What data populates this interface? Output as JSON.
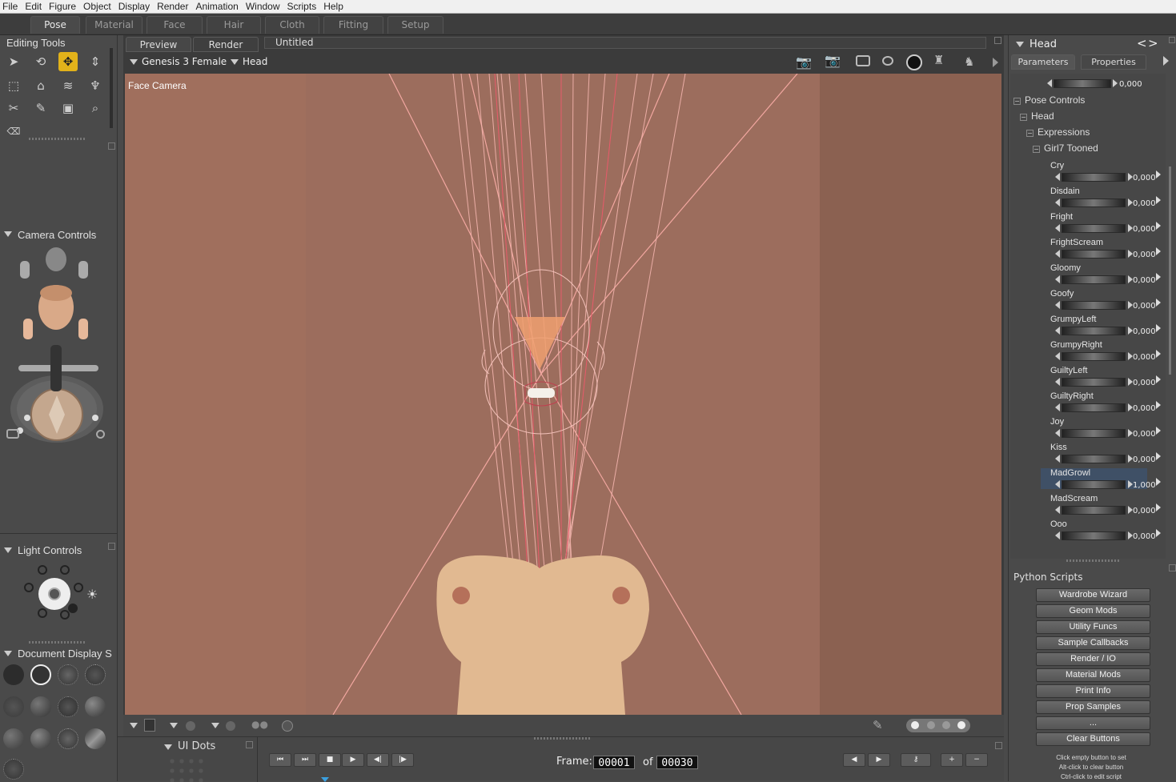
{
  "menu": [
    "File",
    "Edit",
    "Figure",
    "Object",
    "Display",
    "Render",
    "Animation",
    "Window",
    "Scripts",
    "Help"
  ],
  "rooms": [
    "Pose",
    "Material",
    "Face",
    "Hair",
    "Cloth",
    "Fitting",
    "Setup"
  ],
  "left": {
    "editing_tools": "Editing Tools",
    "camera_controls": "Camera Controls",
    "light_controls": "Light Controls",
    "document_display": "Document Display S",
    "ui_dots": "UI Dots"
  },
  "viewport": {
    "tabs": [
      "Preview",
      "Render"
    ],
    "doc_title": "Untitled",
    "figure": "Genesis 3 Female",
    "actor": "Head",
    "camera_label": "Face Camera"
  },
  "animation": {
    "frame_label": "Frame:",
    "current_frame": "00001",
    "of_label": "of",
    "total_frames": "00030"
  },
  "right": {
    "actor": "Head",
    "nav_prev": "<",
    "nav_next": ">",
    "tabs": [
      "Parameters",
      "Properties"
    ],
    "top_value": "0,000",
    "tree": [
      "Pose Controls",
      "Head",
      "Expressions",
      "Girl7 Tooned"
    ],
    "dials": [
      {
        "name": "Cry",
        "value": "0,000"
      },
      {
        "name": "Disdain",
        "value": "0,000"
      },
      {
        "name": "Fright",
        "value": "0,000"
      },
      {
        "name": "FrightScream",
        "value": "0,000"
      },
      {
        "name": "Gloomy",
        "value": "0,000"
      },
      {
        "name": "Goofy",
        "value": "0,000"
      },
      {
        "name": "GrumpyLeft",
        "value": "0,000"
      },
      {
        "name": "GrumpyRight",
        "value": "0,000"
      },
      {
        "name": "GuiltyLeft",
        "value": "0,000"
      },
      {
        "name": "GuiltyRight",
        "value": "0,000"
      },
      {
        "name": "Joy",
        "value": "0,000"
      },
      {
        "name": "Kiss",
        "value": "0,000"
      },
      {
        "name": "MadGrowl",
        "value": "1,000"
      },
      {
        "name": "MadScream",
        "value": "0,000"
      },
      {
        "name": "Ooo",
        "value": "0,000"
      }
    ],
    "python_title": "Python Scripts",
    "python_buttons": [
      "Wardrobe Wizard",
      "Geom Mods",
      "Utility Funcs",
      "Sample Callbacks",
      "Render / IO",
      "Material Mods",
      "Print Info",
      "Prop Samples",
      "...",
      "Clear Buttons"
    ],
    "hints": [
      "Click empty button to set",
      "Alt-click to clear button",
      "Ctrl-click to edit script"
    ]
  }
}
